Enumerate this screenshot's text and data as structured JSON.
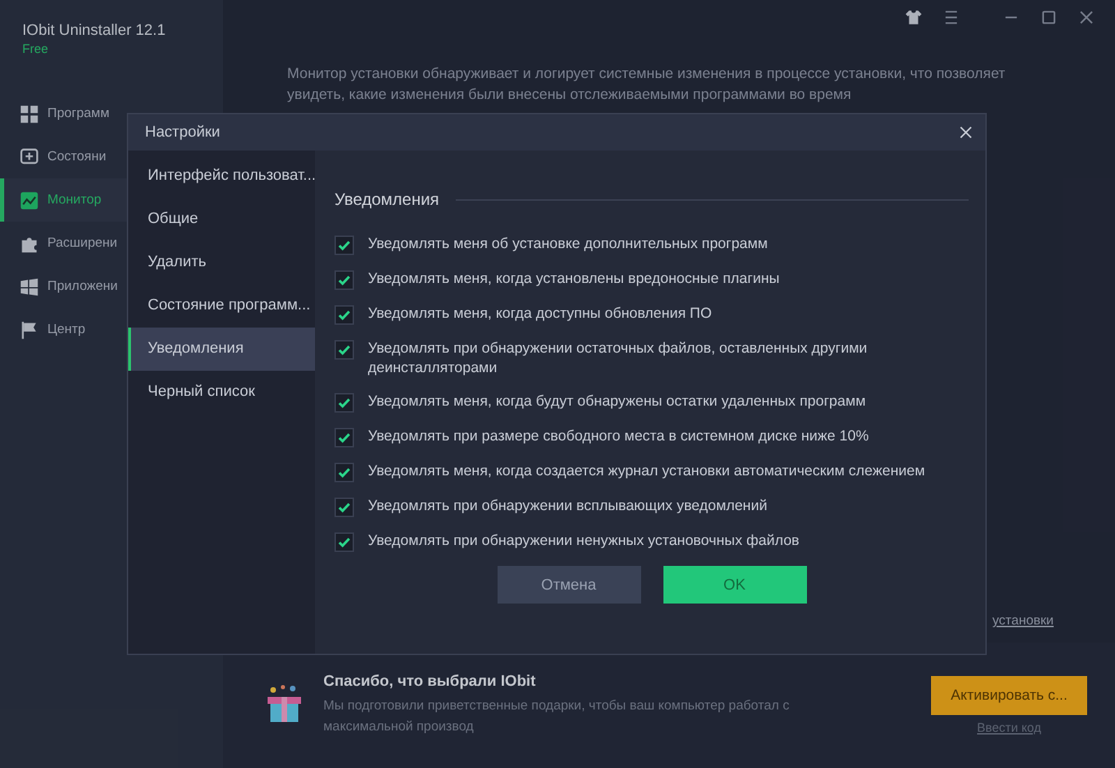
{
  "app": {
    "title": "IObit Uninstaller 12.1",
    "edition": "Free",
    "sidebar": [
      {
        "label": "Программ",
        "selected": false
      },
      {
        "label": "Состояни",
        "selected": false
      },
      {
        "label": "Монитор",
        "selected": true
      },
      {
        "label": "Расширени",
        "selected": false
      },
      {
        "label": "Приложени",
        "selected": false
      },
      {
        "label": "Центр",
        "selected": false
      }
    ],
    "description": "Монитор установки обнаруживает и логирует системные изменения в процессе установки, что позволяет увидеть, какие изменения были внесены отслеживаемыми программами во время",
    "side_link": "установки",
    "promo": {
      "title": "Спасибо, что выбрали IObit",
      "text": "Мы подготовили приветственные подарки, чтобы ваш компьютер работал с максимальной производ",
      "button": "Активировать с...",
      "link": "Ввести код"
    }
  },
  "dialog": {
    "title": "Настройки",
    "nav": [
      {
        "label": "Интерфейс пользоват...",
        "selected": false
      },
      {
        "label": "Общие",
        "selected": false
      },
      {
        "label": "Удалить",
        "selected": false
      },
      {
        "label": "Состояние программ...",
        "selected": false
      },
      {
        "label": "Уведомления",
        "selected": true
      },
      {
        "label": "Черный список",
        "selected": false
      }
    ],
    "section": "Уведомления",
    "options": [
      {
        "label": "Уведомлять меня об установке дополнительных программ",
        "checked": true
      },
      {
        "label": "Уведомлять меня, когда установлены вредоносные плагины",
        "checked": true
      },
      {
        "label": "Уведомлять меня, когда доступны обновления ПО",
        "checked": true
      },
      {
        "label": "Уведомлять при обнаружении остаточных файлов, оставленных другими деинсталляторами",
        "checked": true
      },
      {
        "label": "Уведомлять меня, когда будут обнаружены остатки удаленных программ",
        "checked": true
      },
      {
        "label": "Уведомлять при размере свободного места в системном диске ниже 10%",
        "checked": true
      },
      {
        "label": "Уведомлять меня, когда создается журнал установки автоматическим слежением",
        "checked": true
      },
      {
        "label": "Уведомлять при обнаружении всплывающих уведомлений",
        "checked": true
      },
      {
        "label": "Уведомлять при обнаружении ненужных установочных файлов",
        "checked": true
      }
    ],
    "buttons": [
      {
        "label": "Отмена",
        "kind": "secondary"
      },
      {
        "label": "OK",
        "kind": "primary"
      }
    ]
  }
}
